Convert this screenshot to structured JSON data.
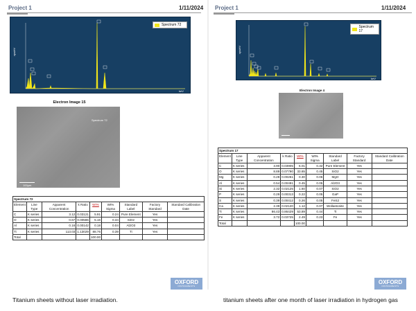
{
  "left": {
    "project": "Project 1",
    "date": "1/11/2024",
    "spectrum": {
      "legend": "Spectrum 72",
      "x_unit": "keV",
      "y_unit": "cps/eV",
      "yticks": [
        "35",
        "30",
        "25",
        "20",
        "15",
        "10",
        "5"
      ],
      "xticks": [
        "0",
        "2",
        "4",
        "6",
        "8",
        "10",
        "12",
        "14"
      ],
      "peaks": [
        "O",
        "Ti",
        "C",
        "Al",
        "Ti",
        "Ti",
        "Ti"
      ]
    },
    "image_title": "Electron Image 15",
    "image_note": "Spectrum 72",
    "scale_label": "100µm",
    "table": {
      "caption": "Spectrum 72",
      "headers": [
        "Element",
        "Line Type",
        "Apparent Concentration",
        "k Ratio",
        "Wt%",
        "Wt% Sigma",
        "Standard Label",
        "Factory Standard",
        "Standard Calibration Date"
      ],
      "rows": [
        [
          "C",
          "K series",
          "3.12",
          "0.03121",
          "5.91",
          "0.24",
          "Pure Element",
          "Yes",
          ""
        ],
        [
          "O",
          "K series",
          "0.67",
          "0.00586",
          "5.16",
          "0.34",
          "SiO2",
          "Yes",
          ""
        ],
        [
          "Al",
          "K series",
          "0.16",
          "0.00142",
          "0.18",
          "0.04",
          "Al2O3",
          "Yes",
          ""
        ],
        [
          "Ti",
          "K series",
          "113.03",
          "1.13029",
          "88.76",
          "0.39",
          "Ti",
          "Yes",
          ""
        ],
        [
          "Total",
          "",
          "",
          "",
          "100.00",
          "",
          "",
          "",
          ""
        ]
      ]
    },
    "logo": {
      "name": "OXFORD",
      "sub": "INSTRUMENTS"
    },
    "caption": "Titanium sheets without laser irradiation."
  },
  "right": {
    "project": "Project 1",
    "date": "1/11/2024",
    "spectrum": {
      "legend": "Spectrum 17",
      "x_unit": "keV",
      "y_unit": "cps/eV",
      "yticks": [
        "25",
        "20",
        "15",
        "10",
        "5"
      ],
      "xticks": [
        "0",
        "2",
        "4",
        "6",
        "8",
        "10",
        "12",
        "14"
      ],
      "peaks": [
        "O",
        "C",
        "Mg",
        "Al",
        "Si",
        "S",
        "Ca",
        "Ti",
        "Ti",
        "Fe",
        "Fe"
      ]
    },
    "image_title": "Electron Image 4",
    "table": {
      "caption": "Spectrum 17",
      "headers": [
        "Element",
        "Line Type",
        "Apparent Concentration",
        "k Ratio",
        "Wt%",
        "Wt% Sigma",
        "Standard Label",
        "Factory Standard",
        "Standard Calibration Date"
      ],
      "rows": [
        [
          "C",
          "K series",
          "3.90",
          "0.03905",
          "6.01",
          "0.32",
          "Pure Element",
          "Yes",
          ""
        ],
        [
          "O",
          "K series",
          "8.89",
          "0.07790",
          "33.65",
          "0.45",
          "SiO2",
          "Yes",
          ""
        ],
        [
          "Mg",
          "K series",
          "0.28",
          "0.00261",
          "0.30",
          "0.06",
          "MgO",
          "Yes",
          ""
        ],
        [
          "Al",
          "K series",
          "0.54",
          "0.00491",
          "0.45",
          "0.05",
          "Al2O3",
          "Yes",
          ""
        ],
        [
          "Si",
          "K series",
          "2.32",
          "0.02125",
          "1.60",
          "0.07",
          "SiO2",
          "Yes",
          ""
        ],
        [
          "P",
          "K series",
          "0.29",
          "0.00313",
          "0.22",
          "0.05",
          "GaP",
          "Yes",
          ""
        ],
        [
          "S",
          "K series",
          "0.39",
          "0.00412",
          "0.26",
          "0.05",
          "FeS2",
          "Yes",
          ""
        ],
        [
          "Ca",
          "K series",
          "2.39",
          "0.02120",
          "1.12",
          "0.07",
          "Wollastonite",
          "Yes",
          ""
        ],
        [
          "Ti",
          "K series",
          "86.43",
          "0.86429",
          "53.89",
          "0.44",
          "Ti",
          "Yes",
          ""
        ],
        [
          "Fe",
          "K series",
          "3.72",
          "0.03725",
          "2.49",
          "0.23",
          "Fe",
          "Yes",
          ""
        ],
        [
          "Total",
          "",
          "",
          "",
          "100.00",
          "",
          "",
          "",
          ""
        ]
      ]
    },
    "logo": {
      "name": "OXFORD",
      "sub": "INSTRUMENTS"
    },
    "caption": "titanium sheets after one month of laser irradiation in hydrogen gas"
  }
}
